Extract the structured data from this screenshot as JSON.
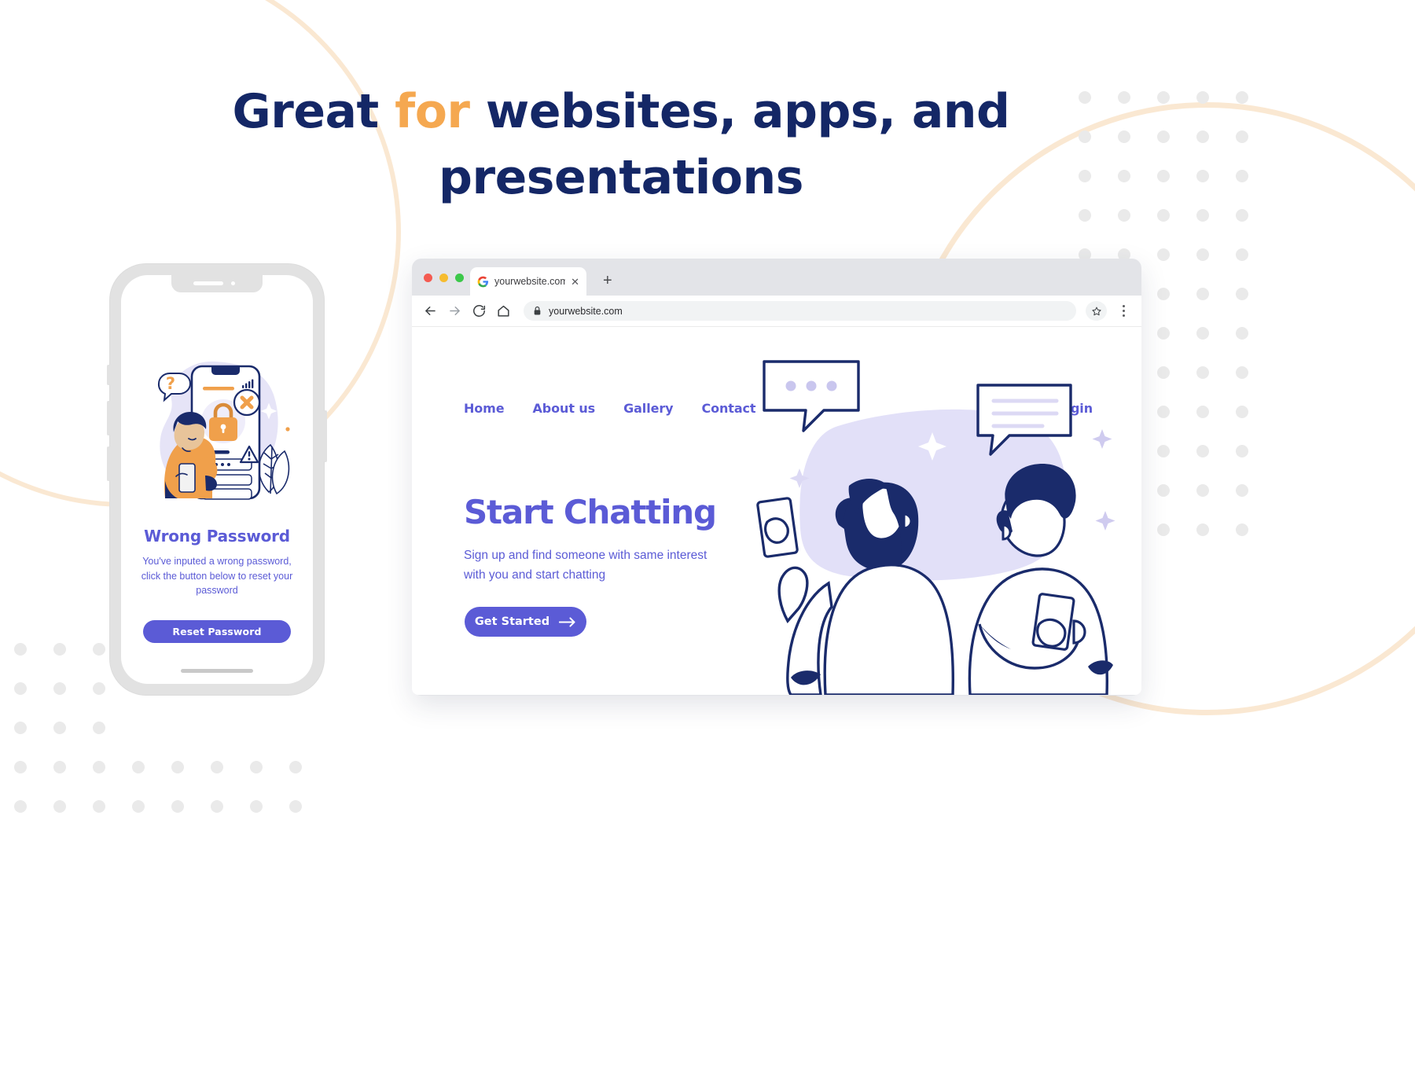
{
  "headline": {
    "line1_pre": "Great ",
    "line1_accent": "for",
    "line1_post": " websites, apps, and",
    "line2": "presentations",
    "color": "#142766",
    "accent_color": "#F5A850"
  },
  "phone": {
    "title": "Wrong Password",
    "body": "You've inputed a wrong password, click the button below to reset your password",
    "button_label": "Reset Password",
    "illustration": {
      "name": "wrong-password-illustration",
      "elements": [
        "question-mark-bubble",
        "smartphone-with-lock",
        "padlock-icon",
        "error-x-badge",
        "warning-triangle-icon",
        "man-in-orange-sweater",
        "leaf-plant",
        "signal-bars"
      ]
    }
  },
  "browser": {
    "tab": {
      "favicon": "google-g-icon",
      "title": "yourwebsite.com",
      "close_label": "✕"
    },
    "new_tab_label": "+",
    "traffic_lights": [
      "#F45B51",
      "#F6BC2F",
      "#3CC84A"
    ],
    "toolbar": {
      "back_icon": "back-arrow-icon",
      "forward_icon": "forward-arrow-icon",
      "reload_icon": "reload-icon",
      "home_icon": "home-icon",
      "lock_icon": "lock-icon",
      "url": "yourwebsite.com",
      "bookmark_icon": "star-icon",
      "menu_icon": "kebab-menu-icon"
    }
  },
  "site": {
    "nav": [
      {
        "label": "Home"
      },
      {
        "label": "About us"
      },
      {
        "label": "Gallery"
      },
      {
        "label": "Contact"
      }
    ],
    "login_label": "Login",
    "hero": {
      "title": "Start Chatting",
      "subtitle": "Sign up and find someone with same interest with you and start chatting",
      "cta_label": "Get Started",
      "cta_icon": "arrow-right-icon"
    },
    "illustration": {
      "name": "two-people-chatting-illustration",
      "elements": [
        "chat-bubble-typing-dots",
        "chat-bubble-text-lines",
        "woman-holding-phone",
        "man-holding-phone",
        "lavender-blob",
        "sparkle-decorations"
      ]
    }
  },
  "colors": {
    "brand_purple": "#5B5BD6",
    "navy": "#142766",
    "illustration_navy": "#1A2B6B",
    "orange": "#F0A04B",
    "peach_arc": "#FAE8D2",
    "lavender_blob": "#E2E0F8",
    "dot_grid": "#EAEAEA"
  }
}
